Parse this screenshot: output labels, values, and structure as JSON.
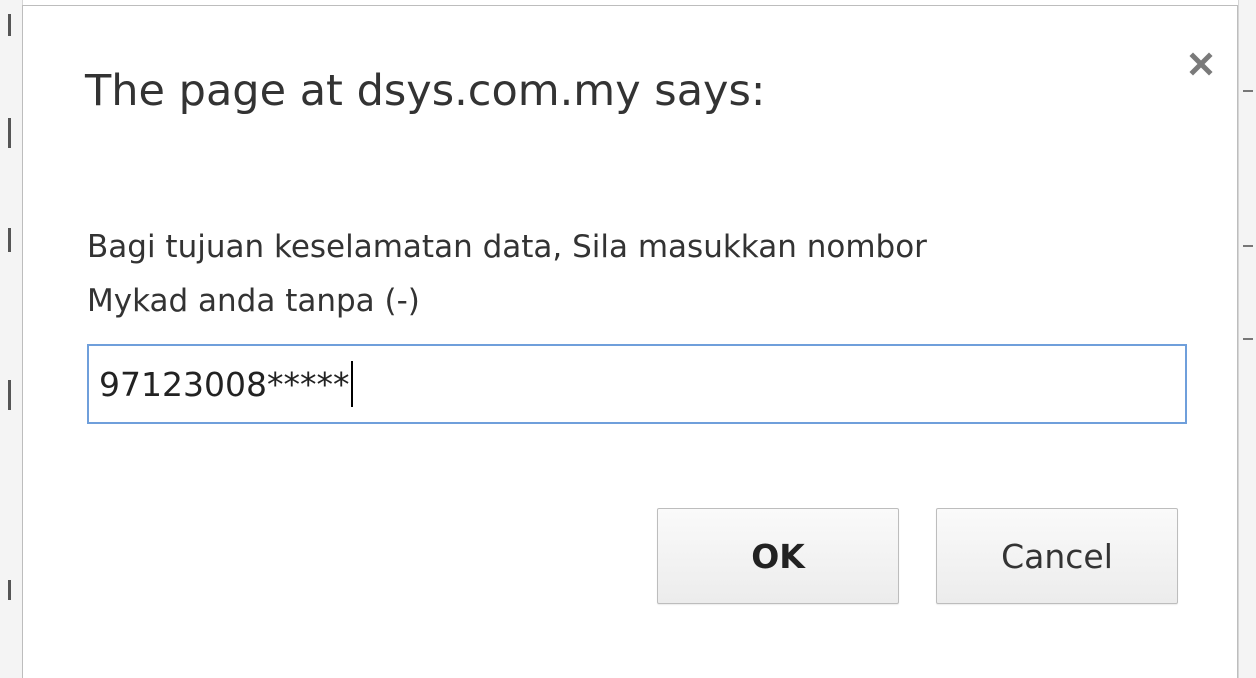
{
  "dialog": {
    "title": "The page at dsys.com.my says:",
    "message_lines": [
      "Bagi tujuan keselamatan data, Sila masukkan nombor",
      "Mykad anda tanpa (-)"
    ],
    "input_value": "97123008*****",
    "ok_label": "OK",
    "cancel_label": "Cancel",
    "close_icon": "close-icon"
  },
  "colors": {
    "input_focus_border": "#6f9fdb",
    "text": "#333333"
  }
}
